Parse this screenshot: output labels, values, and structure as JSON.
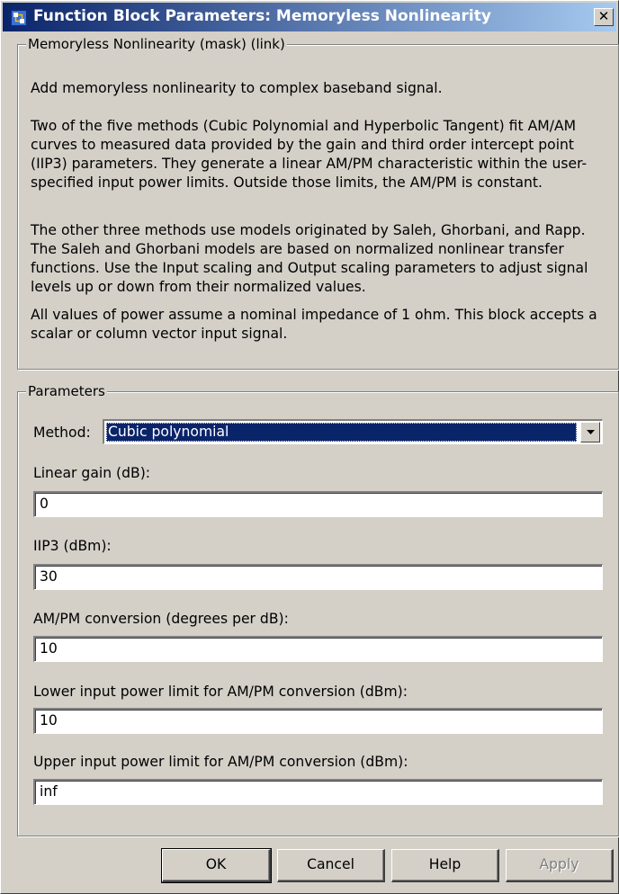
{
  "window": {
    "title": "Function Block Parameters: Memoryless Nonlinearity",
    "close_glyph": "✕",
    "icon": "simulink-block-icon"
  },
  "description": {
    "legend": "Memoryless Nonlinearity (mask) (link)",
    "paragraphs": [
      "Add memoryless nonlinearity to complex baseband signal.",
      "Two of the five methods (Cubic Polynomial and Hyperbolic Tangent) fit AM/AM curves to measured data provided by the gain and third order intercept point (IIP3) parameters. They generate a linear AM/PM characteristic within the user-specified input power limits. Outside those limits, the AM/PM is constant.",
      "The other three methods use models originated by Saleh, Ghorbani, and Rapp. The Saleh and Ghorbani models are based on normalized nonlinear transfer functions. Use the Input scaling and Output scaling parameters to adjust signal levels up or down from their normalized values.",
      "All values of power assume a nominal impedance of 1 ohm. This block accepts a scalar or column vector input signal."
    ]
  },
  "parameters": {
    "legend": "Parameters",
    "method_label": "Method:",
    "method_value": "Cubic polynomial",
    "fields": [
      {
        "label": "Linear gain (dB):",
        "value": "0"
      },
      {
        "label": "IIP3 (dBm):",
        "value": "30"
      },
      {
        "label": "AM/PM conversion (degrees per dB):",
        "value": "10"
      },
      {
        "label": "Lower input power limit for AM/PM conversion (dBm):",
        "value": "10"
      },
      {
        "label": "Upper input power limit for AM/PM conversion (dBm):",
        "value": "inf"
      }
    ]
  },
  "buttons": {
    "ok": "OK",
    "cancel": "Cancel",
    "help": "Help",
    "apply": "Apply"
  },
  "colors": {
    "face": "#d4d0c8",
    "titlebar_start": "#0a246a",
    "titlebar_end": "#a6caf0",
    "selection": "#0a246a"
  }
}
